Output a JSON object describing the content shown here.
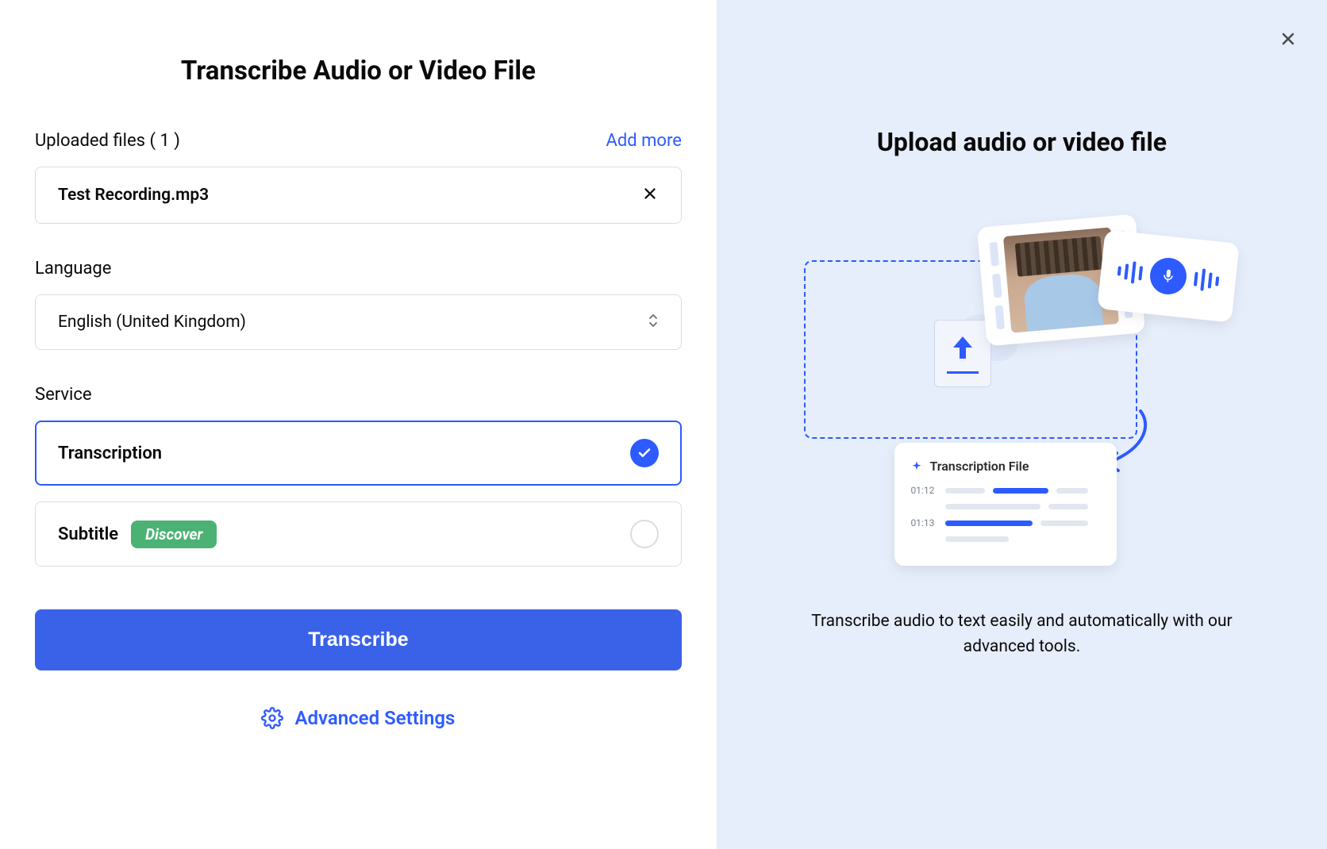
{
  "title": "Transcribe Audio or Video File",
  "uploaded": {
    "label": "Uploaded files ( 1 )",
    "add_more": "Add more",
    "files": [
      {
        "name": "Test Recording.mp3"
      }
    ]
  },
  "language": {
    "label": "Language",
    "value": "English (United Kingdom)"
  },
  "service": {
    "label": "Service",
    "options": {
      "transcription": {
        "label": "Transcription",
        "selected": true
      },
      "subtitle": {
        "label": "Subtitle",
        "badge": "Discover",
        "selected": false
      }
    }
  },
  "actions": {
    "transcribe": "Transcribe",
    "advanced": "Advanced Settings"
  },
  "right": {
    "title": "Upload audio or video file",
    "description": "Transcribe audio to text easily and automatically with our advanced tools.",
    "transcription_card_title": "Transcription File",
    "ts1": "01:12",
    "ts2": "01:13"
  }
}
